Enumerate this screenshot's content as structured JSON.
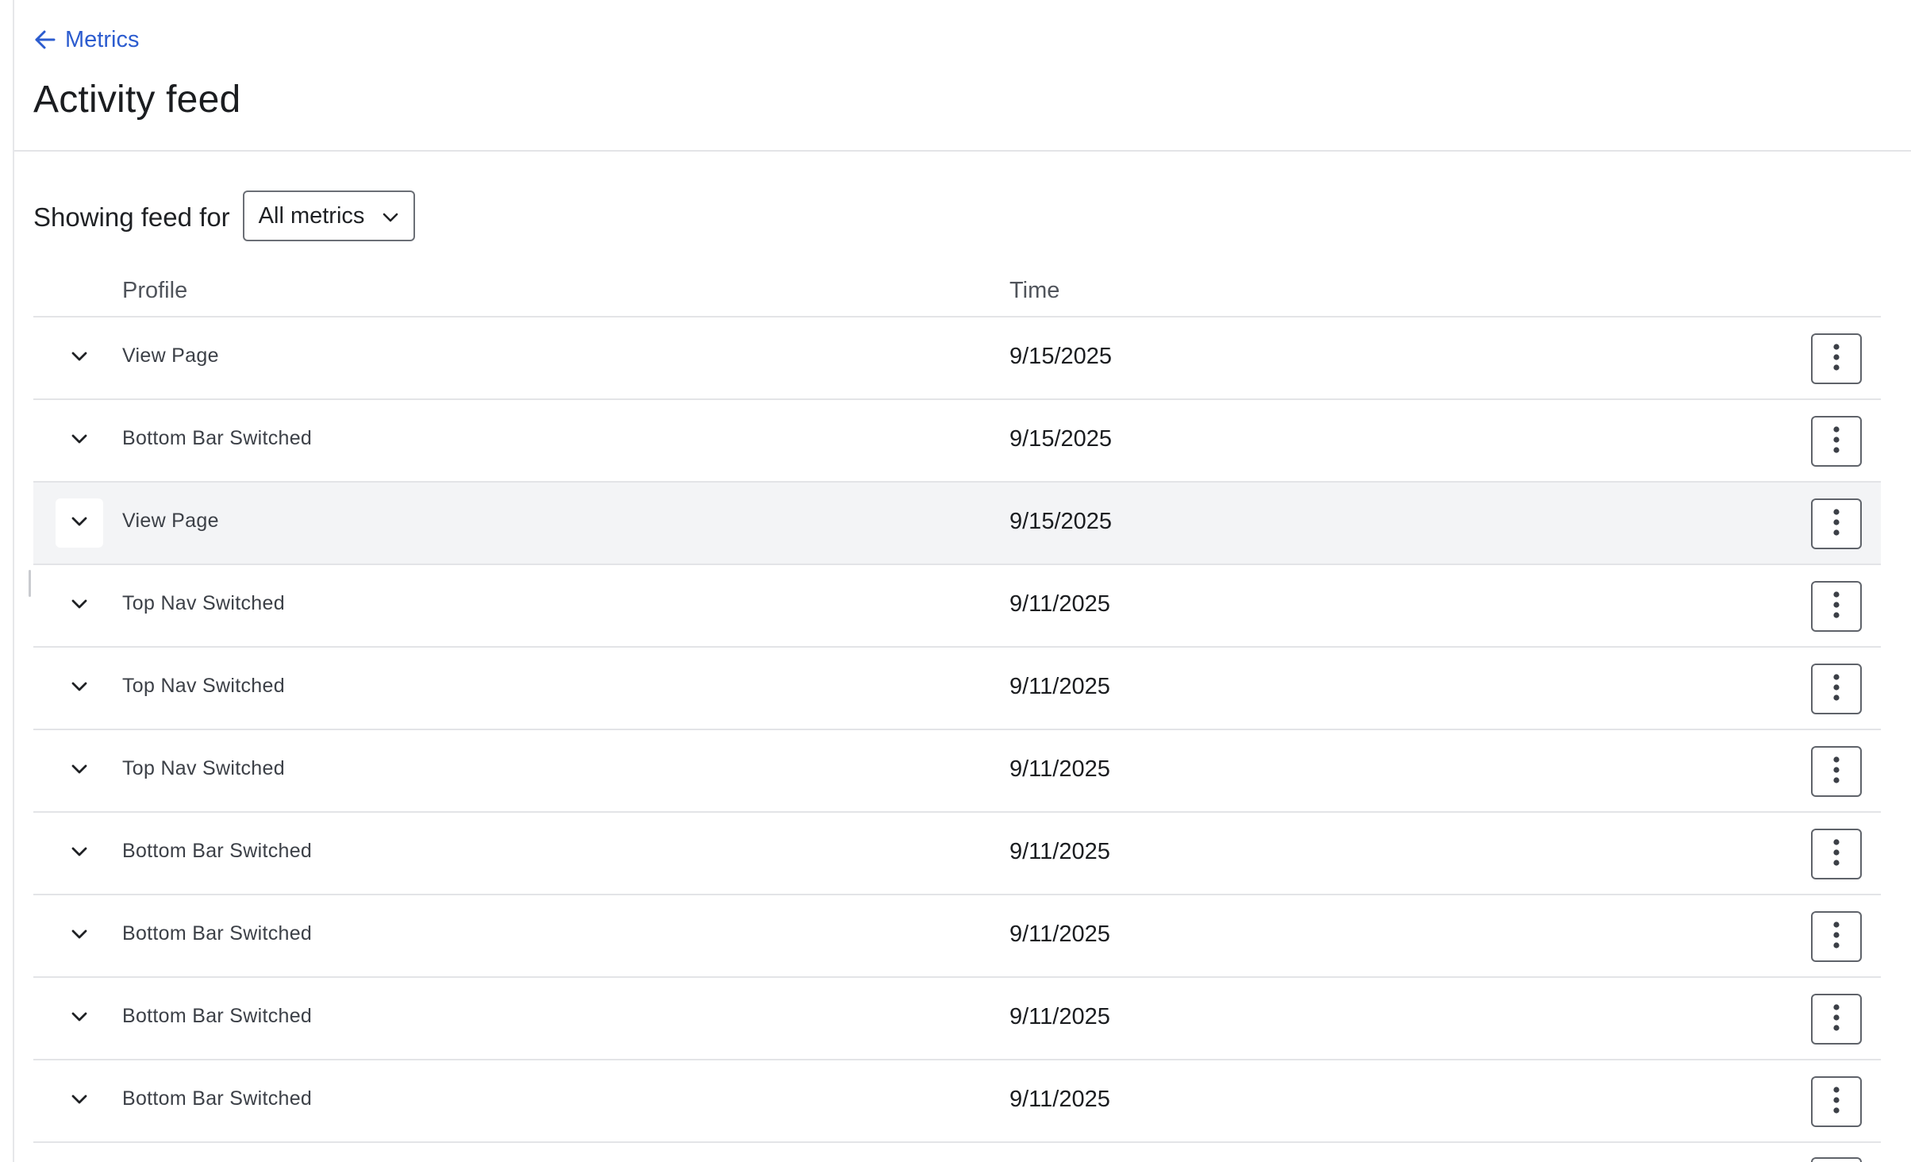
{
  "header": {
    "back_label": "Metrics",
    "title": "Activity feed"
  },
  "filter": {
    "label": "Showing feed for",
    "selected": "All metrics"
  },
  "table": {
    "columns": {
      "profile": "Profile",
      "time": "Time"
    },
    "rows": [
      {
        "event": "View Page",
        "time": "9/15/2025"
      },
      {
        "event": "Bottom Bar Switched",
        "time": "9/15/2025"
      },
      {
        "event": "View Page",
        "time": "9/15/2025"
      },
      {
        "event": "Top Nav Switched",
        "time": "9/11/2025"
      },
      {
        "event": "Top Nav Switched",
        "time": "9/11/2025"
      },
      {
        "event": "Top Nav Switched",
        "time": "9/11/2025"
      },
      {
        "event": "Bottom Bar Switched",
        "time": "9/11/2025"
      },
      {
        "event": "Bottom Bar Switched",
        "time": "9/11/2025"
      },
      {
        "event": "Bottom Bar Switched",
        "time": "9/11/2025"
      },
      {
        "event": "Bottom Bar Switched",
        "time": "9/11/2025"
      }
    ]
  },
  "icons": {
    "back": "arrow-left-icon",
    "dropdown": "chevron-down-icon",
    "expand": "chevron-down-icon",
    "more": "more-vertical-icon"
  },
  "colors": {
    "link": "#2c5ccf",
    "row_hover": "#f3f4f6",
    "divider": "#e3e4e7"
  }
}
